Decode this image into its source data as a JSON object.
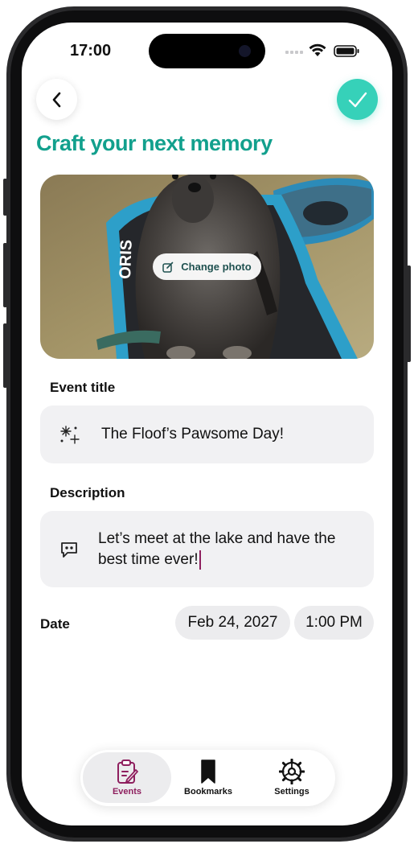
{
  "status_bar": {
    "time": "17:00"
  },
  "header": {
    "title": "Craft your next memory"
  },
  "photo": {
    "change_label": "Change photo"
  },
  "event_title": {
    "label": "Event title",
    "value": "The Floof’s Pawsome Day!"
  },
  "description": {
    "label": "Description",
    "line1": "Let’s meet at the lake and have the",
    "line2": "best time ever!"
  },
  "date": {
    "label": "Date",
    "date_value": "Feb 24, 2027",
    "time_value": "1:00 PM"
  },
  "tabbar": {
    "items": [
      {
        "label": "Events",
        "icon": "clipboard-edit-icon",
        "active": true
      },
      {
        "label": "Bookmarks",
        "icon": "bookmark-icon",
        "active": false
      },
      {
        "label": "Settings",
        "icon": "gear-icon",
        "active": false
      }
    ]
  },
  "colors": {
    "accent": "#12a08d",
    "confirm": "#36d1b9",
    "active_tab": "#8e1f5e",
    "cursor": "#8e1f5e",
    "field_bg": "#f1f1f3"
  }
}
